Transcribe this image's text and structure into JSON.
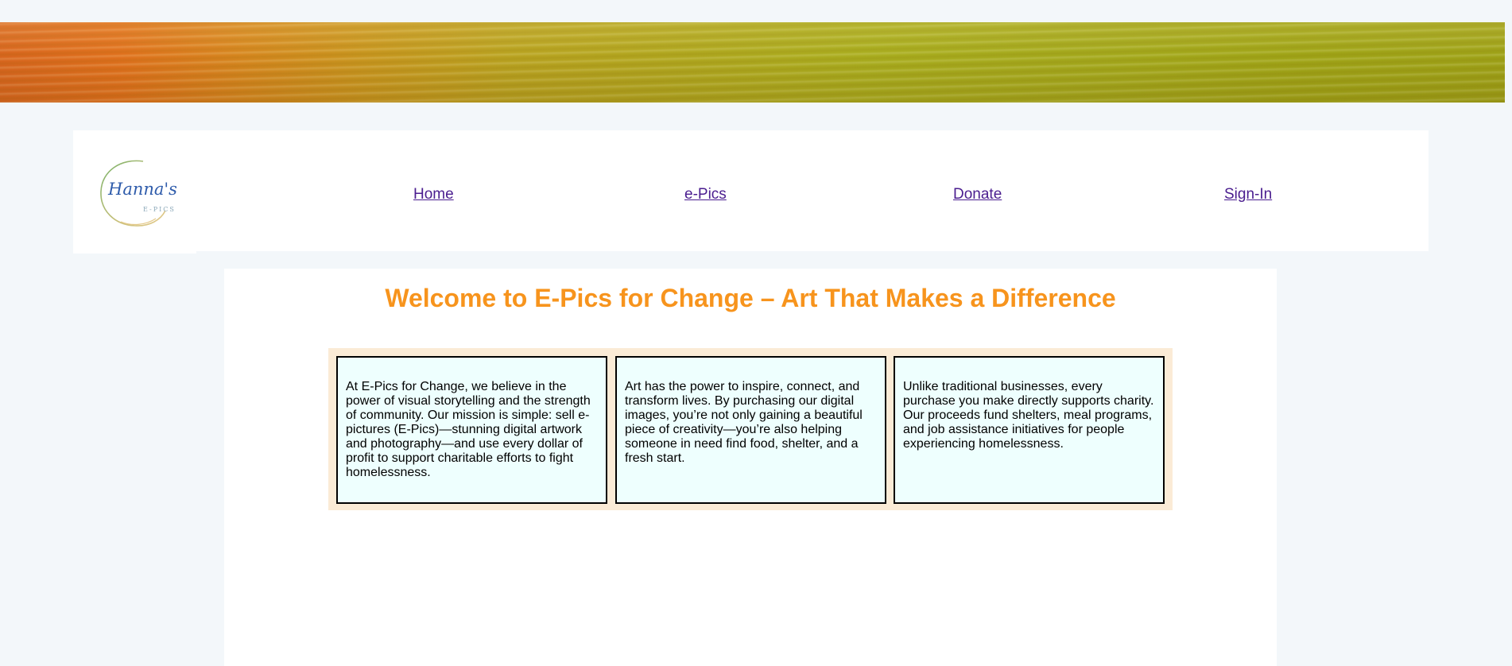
{
  "banner": {
    "description_colors": [
      "#d9661e",
      "#b9a320",
      "#9ea217"
    ]
  },
  "logo": {
    "script_text": "Hanna's",
    "subtext": "E-PICS",
    "icon": "circle-logo-icon"
  },
  "nav": {
    "items": [
      {
        "label": "Home"
      },
      {
        "label": "e-Pics"
      },
      {
        "label": "Donate"
      },
      {
        "label": "Sign-In"
      }
    ],
    "link_color": "#4a1d8f"
  },
  "main": {
    "title": "Welcome to E-Pics for Change – Art That Makes a Difference",
    "title_color": "#f7941d",
    "cards": [
      {
        "text": "At E-Pics for Change, we believe in the power of visual storytelling and the strength of community. Our mission is simple: sell e-pictures (E-Pics)—stunning digital artwork and photography—and use every dollar of profit to support charitable efforts to fight homelessness."
      },
      {
        "text": "Art has the power to inspire, connect, and transform lives. By purchasing our digital images, you’re not only gaining a beautiful piece of creativity—you’re also helping someone in need find food, shelter, and a fresh start."
      },
      {
        "text": "Unlike traditional businesses, every purchase you make directly supports charity. Our proceeds fund shelters, meal programs, and job assistance initiatives for people experiencing homelessness."
      }
    ],
    "card_background": "#eefffe",
    "cards_container_background": "#fbebd6"
  }
}
